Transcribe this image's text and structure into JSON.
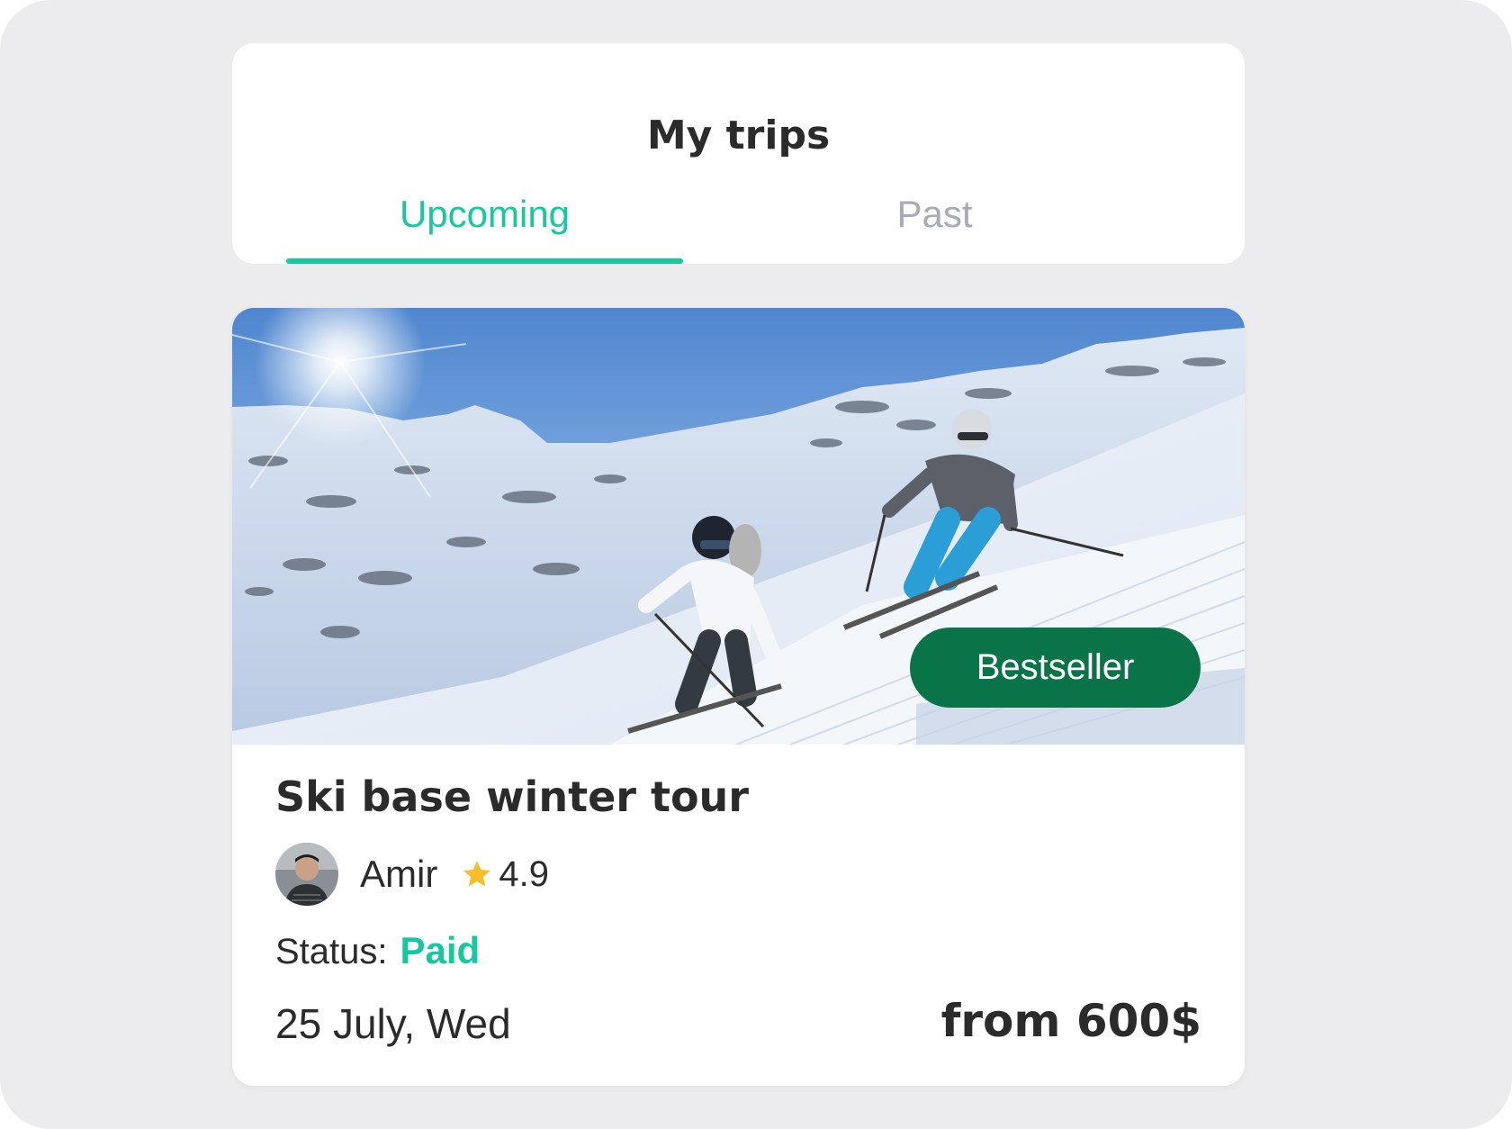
{
  "header": {
    "title": "My trips",
    "tabs": [
      {
        "label": "Upcoming",
        "active": true
      },
      {
        "label": "Past",
        "active": false
      }
    ]
  },
  "trip": {
    "image_alt": "Two skiers descending a snowy slope",
    "badge": "Bestseller",
    "title": "Ski base winter tour",
    "host": {
      "name": "Amir",
      "rating": "4.9",
      "avatar_icon": "avatar-photo"
    },
    "status_label": "Status:",
    "status_value": "Paid",
    "date": "25 July, Wed",
    "price": "from 600$"
  },
  "colors": {
    "accent": "#14c99e",
    "inactive_tab": "#a7aab8",
    "badge_bg": "#087448",
    "text": "#2b2b2b",
    "background": "#ececee",
    "star": "#f7be2b"
  }
}
